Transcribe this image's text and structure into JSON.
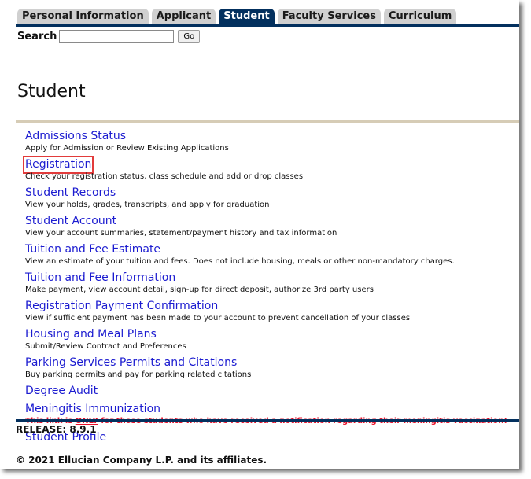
{
  "tabs": [
    {
      "label": "Personal Information",
      "active": false
    },
    {
      "label": "Applicant",
      "active": false
    },
    {
      "label": "Student",
      "active": true
    },
    {
      "label": "Faculty Services",
      "active": false
    },
    {
      "label": "Curriculum",
      "active": false
    }
  ],
  "search": {
    "label": "Search",
    "value": "",
    "placeholder": "",
    "button_label": "Go"
  },
  "page": {
    "title": "Student"
  },
  "menu": [
    {
      "label": "Admissions Status",
      "description": "Apply for Admission or Review Existing Applications"
    },
    {
      "label": "Registration",
      "description": "Check your registration status, class schedule and add or drop classes",
      "highlighted": true
    },
    {
      "label": "Student Records",
      "description": "View your holds, grades, transcripts, and apply for graduation"
    },
    {
      "label": "Student Account",
      "description": "View your account summaries, statement/payment history and tax information"
    },
    {
      "label": "Tuition and Fee Estimate",
      "description": "View an estimate of your tuition and fees. Does not include housing, meals or other non-mandatory charges."
    },
    {
      "label": "Tuition and Fee Information",
      "description": "Make payment, view account detail, sign-up for direct deposit, authorize 3rd party users"
    },
    {
      "label": "Registration Payment Confirmation",
      "description": "View if sufficient payment has been made to your account to prevent cancellation of your classes"
    },
    {
      "label": "Housing and Meal Plans",
      "description": "Submit/Review Contract and Preferences"
    },
    {
      "label": "Parking Services Permits and Citations",
      "description": "Buy parking permits and pay for parking related citations"
    },
    {
      "label": "Degree Audit",
      "description": ""
    },
    {
      "label": "Meningitis Immunization",
      "warning": {
        "before": "This link is ",
        "emphasis": "ONLY",
        "after": " for those students who have received a notification regarding their meningitis vaccination!"
      }
    },
    {
      "label": "Student Profile",
      "description": ""
    }
  ],
  "footer": {
    "release": "RELEASE: 8.9.1",
    "copyright": "© 2021 Ellucian Company L.P. and its affiliates."
  },
  "colors": {
    "nav_accent": "#03305e",
    "link": "#1b1bd0",
    "warning": "#e8102a",
    "divider": "#d6ccb6",
    "highlight_box": "#e23b3b"
  }
}
